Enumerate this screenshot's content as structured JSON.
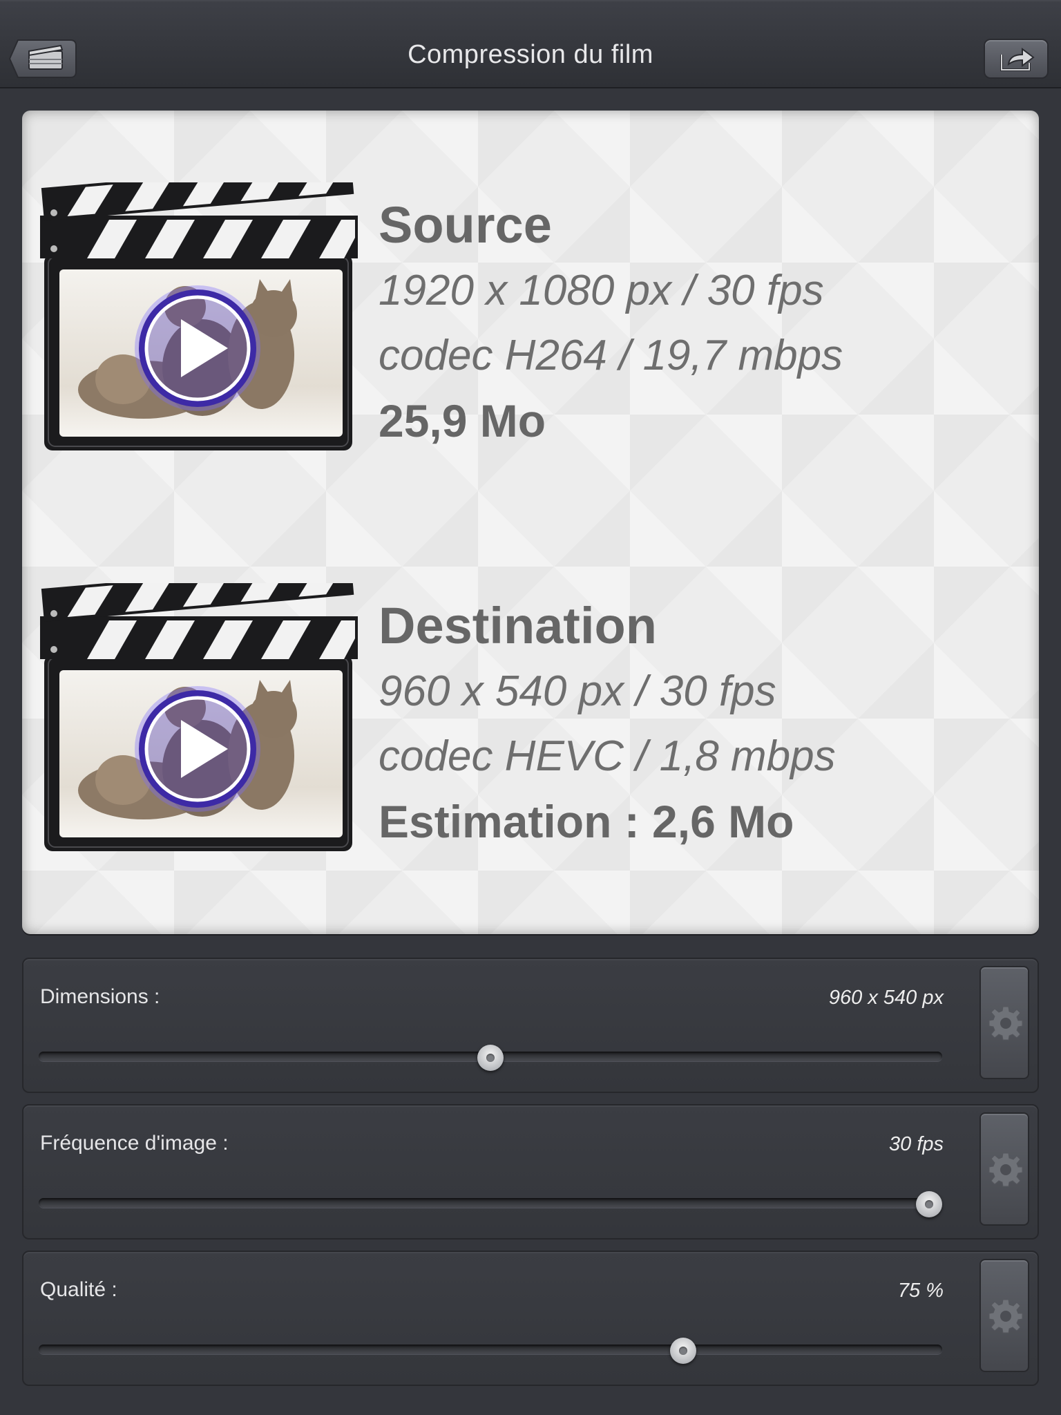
{
  "header": {
    "title": "Compression du film",
    "back_icon": "film-folder-icon",
    "share_icon": "share-icon"
  },
  "source": {
    "heading": "Source",
    "resolution": "1920 x 1080 px / 30 fps",
    "codec": "codec H264 / 19,7 mbps",
    "size": "25,9 Mo"
  },
  "destination": {
    "heading": "Destination",
    "resolution": "960 x 540 px / 30 fps",
    "codec": "codec HEVC / 1,8 mbps",
    "size": "Estimation : 2,6 Mo"
  },
  "sliders": [
    {
      "label": "Dimensions :",
      "value": "960 x 540 px",
      "level": 0.5
    },
    {
      "label": "Fréquence d'image :",
      "value": "30 fps",
      "level": 1.0
    },
    {
      "label": "Qualité :",
      "value": "75 %",
      "level": 0.72
    }
  ],
  "colors": {
    "background": "#34363c",
    "panel": "#ededed",
    "accent_play": "#4b2fb8"
  }
}
